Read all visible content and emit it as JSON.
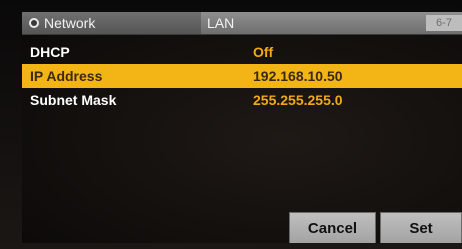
{
  "header": {
    "section": "Network",
    "subsection": "LAN",
    "page": "6-7"
  },
  "rows": [
    {
      "label": "DHCP",
      "value": "Off",
      "selected": false
    },
    {
      "label": "IP Address",
      "value": "192.168.10.50",
      "selected": true
    },
    {
      "label": "Subnet Mask",
      "value": "255.255.255.0",
      "selected": false
    }
  ],
  "buttons": {
    "cancel": "Cancel",
    "set": "Set"
  },
  "colors": {
    "selected_row": "#f3b416",
    "value_text": "#f1a91b",
    "title_bar": "#7a7a7a"
  }
}
